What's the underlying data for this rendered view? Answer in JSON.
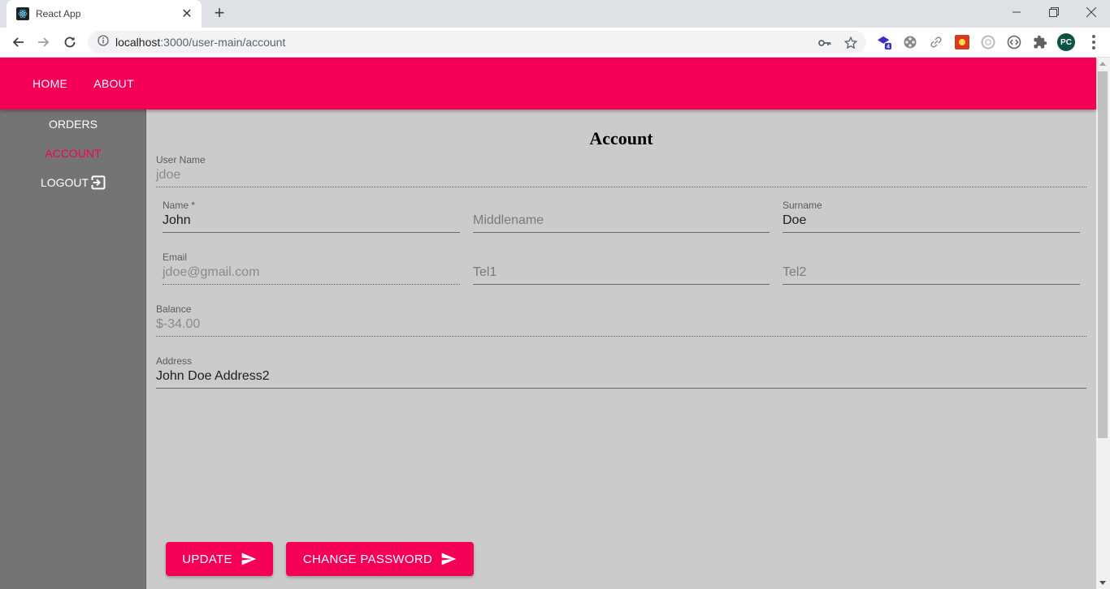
{
  "browser": {
    "tab_title": "React App",
    "url_host": "localhost",
    "url_rest": ":3000/user-main/account",
    "extension_badge": "4",
    "profile_initials": "PC"
  },
  "appbar": {
    "links": [
      "HOME",
      "ABOUT"
    ],
    "color": "#f50057"
  },
  "sidebar": {
    "items": [
      "ORDERS",
      "ACCOUNT",
      "LOGOUT"
    ],
    "active": "ACCOUNT"
  },
  "page": {
    "title": "Account"
  },
  "form": {
    "username": {
      "label": "User Name",
      "value": "jdoe"
    },
    "name": {
      "label": "Name *",
      "value": "John"
    },
    "middlename": {
      "placeholder": "Middlename"
    },
    "surname": {
      "label": "Surname",
      "value": "Doe"
    },
    "email": {
      "label": "Email",
      "value": "jdoe@gmail.com"
    },
    "tel1": {
      "placeholder": "Tel1"
    },
    "tel2": {
      "placeholder": "Tel2"
    },
    "balance": {
      "label": "Balance",
      "value": "$-34.00"
    },
    "address": {
      "label": "Address",
      "value": "John Doe Address2"
    }
  },
  "buttons": {
    "update": "UPDATE",
    "change_password": "CHANGE PASSWORD"
  }
}
